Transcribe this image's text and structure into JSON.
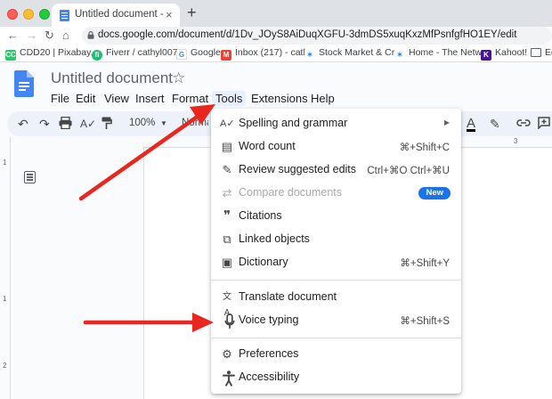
{
  "browser": {
    "tab_title": "Untitled document - Google Docs",
    "tab_close": "×",
    "new_tab": "+",
    "url": "docs.google.com/document/d/1Dv_JOyS8AiDuqXGFU-3dmDS5xuqKxzMfPsnfgfHO1EY/edit",
    "nav": {
      "back": "←",
      "forward": "→",
      "reload": "↻",
      "home": "⌂"
    },
    "bookmarks": [
      {
        "label": "CDD20 | Pixabay...",
        "icon": "pixabay-icon",
        "icon_text": "CC",
        "color": "#2ec66d"
      },
      {
        "label": "Fiverr / cathyl007...",
        "icon": "fiverr-icon",
        "icon_text": "fi",
        "color": "#1dbf73"
      },
      {
        "label": "Google",
        "icon": "google-icon",
        "icon_text": "G",
        "color": "#4285f4"
      },
      {
        "label": "Inbox (217) - cath...",
        "icon": "gmail-icon",
        "icon_text": "M",
        "color": "#ea4335"
      },
      {
        "label": "Stock Market & Cr...",
        "icon": "stock-icon",
        "icon_text": "✶",
        "color": "#1e88e5"
      },
      {
        "label": "Home - The Netw...",
        "icon": "network-icon",
        "icon_text": "✶",
        "color": "#1e88e5"
      },
      {
        "label": "Kahoot!",
        "icon": "kahoot-icon",
        "icon_text": "K",
        "color": "#46178f"
      },
      {
        "label": "Ed",
        "icon": "folder-icon",
        "icon_text": "",
        "color": "#5f6368"
      }
    ]
  },
  "docs": {
    "title": "Untitled document",
    "star": "☆",
    "menus": [
      "File",
      "Edit",
      "View",
      "Insert",
      "Format",
      "Tools",
      "Extensions",
      "Help"
    ]
  },
  "toolbar": {
    "zoom": "100%",
    "style": "Normal",
    "text_color_letter": "A"
  },
  "ruler": {
    "left_marks": [
      "1",
      "1",
      "2"
    ],
    "top_mark": "3"
  },
  "tools_menu": {
    "items": [
      {
        "label": "Spelling and grammar",
        "icon": "spellcheck-icon",
        "glyph": "A✓",
        "shortcut": "",
        "submenu": true
      },
      {
        "label": "Word count",
        "icon": "word-count-icon",
        "glyph": "▤",
        "shortcut": "⌘+Shift+C"
      },
      {
        "label": "Review suggested edits",
        "icon": "review-edits-icon",
        "glyph": "✎",
        "shortcut": "Ctrl+⌘O Ctrl+⌘U"
      },
      {
        "label": "Compare documents",
        "icon": "compare-icon",
        "glyph": "⇄",
        "shortcut": "",
        "badge": "New",
        "disabled": true
      },
      {
        "label": "Citations",
        "icon": "citations-icon",
        "glyph": "❞",
        "shortcut": ""
      },
      {
        "label": "Linked objects",
        "icon": "linked-objects-icon",
        "glyph": "⧉",
        "shortcut": ""
      },
      {
        "label": "Dictionary",
        "icon": "dictionary-icon",
        "glyph": "▣",
        "shortcut": "⌘+Shift+Y"
      },
      {
        "label": "Translate document",
        "icon": "translate-icon",
        "glyph": "文A",
        "shortcut": ""
      },
      {
        "label": "Voice typing",
        "icon": "microphone-icon",
        "glyph": "🎙",
        "shortcut": "⌘+Shift+S"
      },
      {
        "label": "Preferences",
        "icon": "preferences-icon",
        "glyph": "⚙",
        "shortcut": ""
      },
      {
        "label": "Accessibility",
        "icon": "accessibility-icon",
        "glyph": "♿",
        "shortcut": ""
      }
    ]
  },
  "colors": {
    "arrow": "#e8271f",
    "accent": "#1a73e8",
    "tools_highlight": "#e8f0fe"
  }
}
